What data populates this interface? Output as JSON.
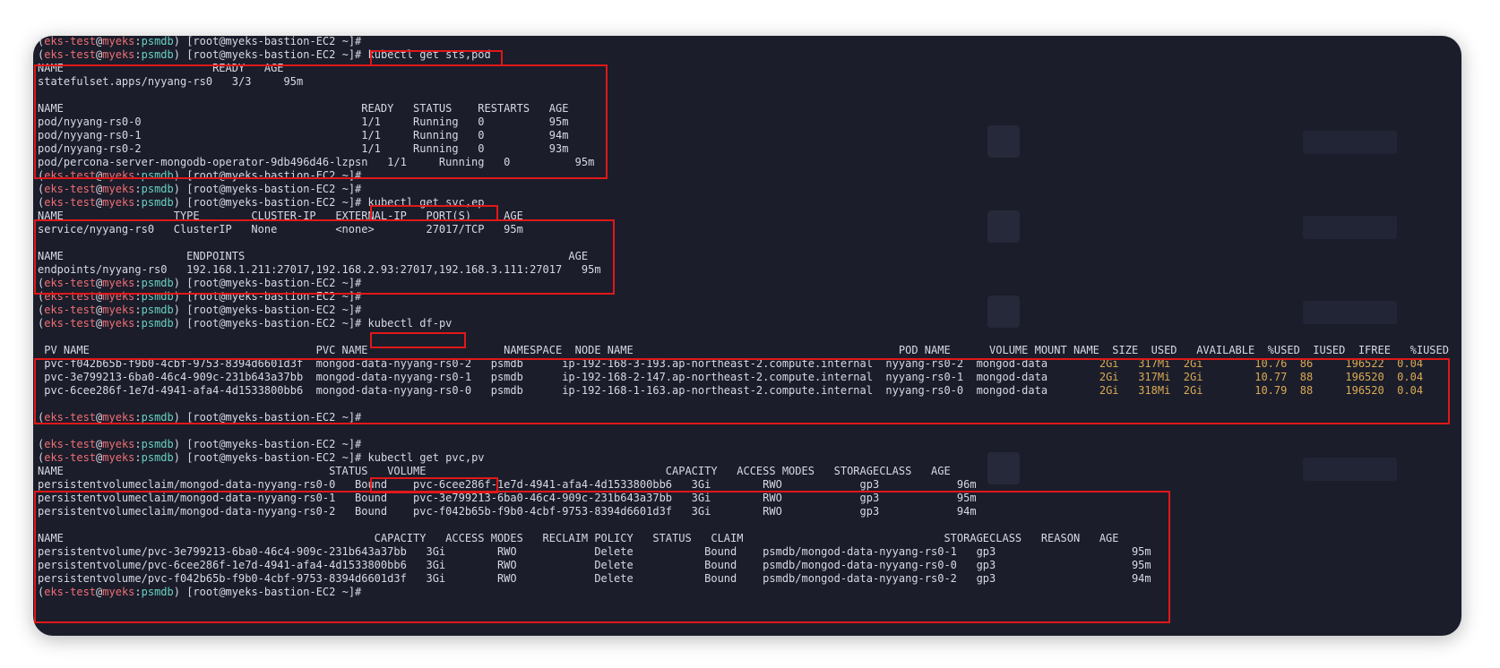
{
  "prompt": {
    "user": "eks-test",
    "at": "@",
    "host": "myeks",
    "sep": ":",
    "namespace": "psmdb",
    "shell": ") [root@myeks-bastion-EC2 ~]#"
  },
  "commands": {
    "sts_pod": " kubectl get sts,pod",
    "svc_ep": " kubectl get svc,ep",
    "df_pv": " kubectl df-pv",
    "pvc_pv": " kubectl get pvc,pv"
  },
  "sts": {
    "header": "NAME                       READY   AGE",
    "rows": [
      "statefulset.apps/nyyang-rs0   3/3     95m"
    ]
  },
  "pods": {
    "header": "NAME                                              READY   STATUS    RESTARTS   AGE",
    "rows": [
      "pod/nyyang-rs0-0                                  1/1     Running   0          95m",
      "pod/nyyang-rs0-1                                  1/1     Running   0          94m",
      "pod/nyyang-rs0-2                                  1/1     Running   0          93m",
      "pod/percona-server-mongodb-operator-9db496d46-lzpsn   1/1     Running   0          95m"
    ]
  },
  "svc": {
    "header": "NAME                 TYPE        CLUSTER-IP   EXTERNAL-IP   PORT(S)     AGE",
    "rows": [
      "service/nyyang-rs0   ClusterIP   None         <none>        27017/TCP   95m"
    ]
  },
  "ep": {
    "header": "NAME                   ENDPOINTS                                                  AGE",
    "rows": [
      "endpoints/nyyang-rs0   192.168.1.211:27017,192.168.2.93:27017,192.168.3.111:27017   95m"
    ]
  },
  "dfpv": {
    "header": " PV NAME                                   PVC NAME                     NAMESPACE  NODE NAME                                         POD NAME      VOLUME MOUNT NAME  SIZE  USED   AVAILABLE  %USED  IUSED  IFREE   %IUSED",
    "rows": [
      {
        "text": " pvc-f042b65b-f9b0-4cbf-9753-8394d6601d3f  mongod-data-nyyang-rs0-2   psmdb      ip-192-168-3-193.ap-northeast-2.compute.internal  nyyang-rs0-2  mongod-data        ",
        "metrics": "2Gi   317Mi  2Gi        10.76  86     196522  0.04"
      },
      {
        "text": " pvc-3e799213-6ba0-46c4-909c-231b643a37bb  mongod-data-nyyang-rs0-1   psmdb      ip-192-168-2-147.ap-northeast-2.compute.internal  nyyang-rs0-1  mongod-data        ",
        "metrics": "2Gi   317Mi  2Gi        10.77  88     196520  0.04"
      },
      {
        "text": " pvc-6cee286f-1e7d-4941-afa4-4d1533800bb6  mongod-data-nyyang-rs0-0   psmdb      ip-192-168-1-163.ap-northeast-2.compute.internal  nyyang-rs0-0  mongod-data        ",
        "metrics": "2Gi   318Mi  2Gi        10.79  88     196520  0.04"
      }
    ]
  },
  "pvc": {
    "header": "NAME                                         STATUS   VOLUME                                     CAPACITY   ACCESS MODES   STORAGECLASS   AGE",
    "rows": [
      "persistentvolumeclaim/mongod-data-nyyang-rs0-0   Bound    pvc-6cee286f-1e7d-4941-afa4-4d1533800bb6   3Gi        RWO            gp3            96m",
      "persistentvolumeclaim/mongod-data-nyyang-rs0-1   Bound    pvc-3e799213-6ba0-46c4-909c-231b643a37bb   3Gi        RWO            gp3            95m",
      "persistentvolumeclaim/mongod-data-nyyang-rs0-2   Bound    pvc-f042b65b-f9b0-4cbf-9753-8394d6601d3f   3Gi        RWO            gp3            94m"
    ]
  },
  "pv": {
    "header": "NAME                                                CAPACITY   ACCESS MODES   RECLAIM POLICY   STATUS   CLAIM                               STORAGECLASS   REASON   AGE",
    "rows": [
      "persistentvolume/pvc-3e799213-6ba0-46c4-909c-231b643a37bb   3Gi        RWO            Delete           Bound    psmdb/mongod-data-nyyang-rs0-1   gp3                     95m",
      "persistentvolume/pvc-6cee286f-1e7d-4941-afa4-4d1533800bb6   3Gi        RWO            Delete           Bound    psmdb/mongod-data-nyyang-rs0-0   gp3                     95m",
      "persistentvolume/pvc-f042b65b-f9b0-4cbf-9753-8394d6601d3f   3Gi        RWO            Delete           Bound    psmdb/mongod-data-nyyang-rs0-2   gp3                     94m"
    ]
  },
  "colors": {
    "terminal_bg": "#1b1d2b",
    "prompt_user": "#ef6f73",
    "prompt_host": "#68d1c0",
    "metrics": "#d9aa52",
    "highlight_box": "#e01818"
  }
}
